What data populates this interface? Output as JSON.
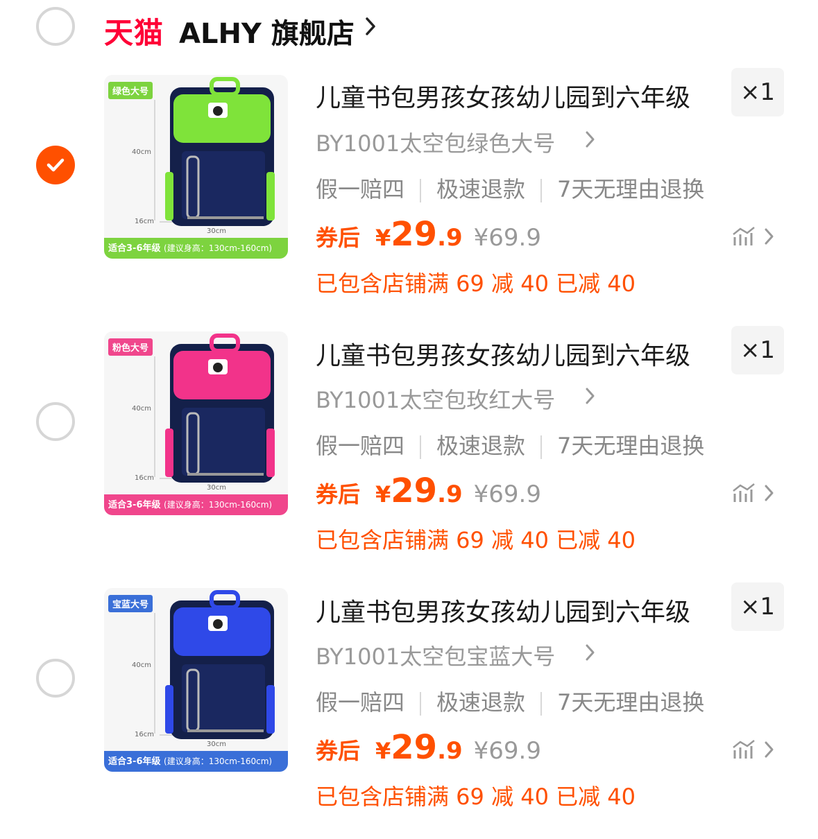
{
  "shop": {
    "platform_logo": "天猫",
    "name": "ALHY 旗舰店"
  },
  "items": [
    {
      "title": "儿童书包男孩女孩幼儿园到六年级",
      "qty": "×1",
      "sku": "BY1001太空包绿色大号",
      "services": [
        "假一赔四",
        "极速退款",
        "7天无理由退换"
      ],
      "coupon_label": "券后",
      "currency": "¥",
      "price_int": "29",
      "price_dec": ".9",
      "original_price": "¥69.9",
      "promo": "已包含店铺满 69 减 40 已减 40",
      "selected": true,
      "image": {
        "tag": "绿色大号",
        "fit_text": "适合3-6年级",
        "fit_sub": "(建议身高：130cm-160cm)",
        "dim_height": "40cm",
        "dim_depth": "16cm",
        "dim_width": "30cm",
        "accent_color": "#7dd33f",
        "flap_color": "#7fe33a"
      }
    },
    {
      "title": "儿童书包男孩女孩幼儿园到六年级",
      "qty": "×1",
      "sku": "BY1001太空包玫红大号",
      "services": [
        "假一赔四",
        "极速退款",
        "7天无理由退换"
      ],
      "coupon_label": "券后",
      "currency": "¥",
      "price_int": "29",
      "price_dec": ".9",
      "original_price": "¥69.9",
      "promo": "已包含店铺满 69 减 40 已减 40",
      "selected": false,
      "image": {
        "tag": "粉色大号",
        "fit_text": "适合3-6年级",
        "fit_sub": "(建议身高：130cm-160cm)",
        "dim_height": "40cm",
        "dim_depth": "16cm",
        "dim_width": "30cm",
        "accent_color": "#f0468c",
        "flap_color": "#f2338a"
      }
    },
    {
      "title": "儿童书包男孩女孩幼儿园到六年级",
      "qty": "×1",
      "sku": "BY1001太空包宝蓝大号",
      "services": [
        "假一赔四",
        "极速退款",
        "7天无理由退换"
      ],
      "coupon_label": "券后",
      "currency": "¥",
      "price_int": "29",
      "price_dec": ".9",
      "original_price": "¥69.9",
      "promo": "已包含店铺满 69 减 40 已减 40",
      "selected": false,
      "image": {
        "tag": "宝蓝大号",
        "fit_text": "适合3-6年级",
        "fit_sub": "(建议身高：130cm-160cm)",
        "dim_height": "40cm",
        "dim_depth": "16cm",
        "dim_width": "30cm",
        "accent_color": "#3a6fd8",
        "flap_color": "#2f49e8"
      }
    }
  ],
  "colors": {
    "brand_orange": "#ff5000",
    "tmall_red": "#ff0036",
    "muted_text": "#999999"
  }
}
